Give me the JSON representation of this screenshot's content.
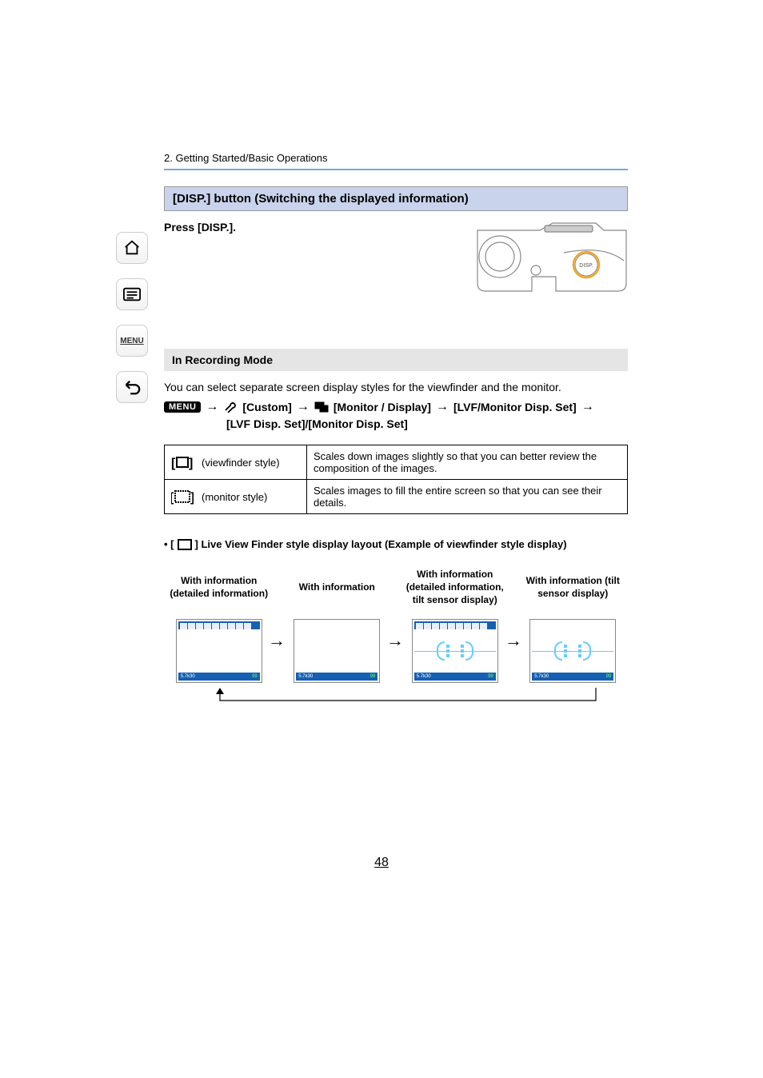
{
  "breadcrumb": "2. Getting Started/Basic Operations",
  "section_title": "[DISP.] button (Switching the displayed information)",
  "press_text": "Press [DISP.].",
  "disp_button_label": "DISP.",
  "subsection_title": "In Recording Mode",
  "intro_text": "You can select separate screen display styles for the viewfinder and the monitor.",
  "menu_path": {
    "menu_chip": "MENU",
    "arrow": "→",
    "custom": "[Custom]",
    "monitor_display": "[Monitor / Display]",
    "lvf_monitor": "[LVF/Monitor Disp. Set]",
    "line2": "[LVF Disp. Set]/[Monitor Disp. Set]"
  },
  "styles_table": {
    "row1": {
      "label": "(viewfinder style)",
      "desc": "Scales down images slightly so that you can better review the composition of the images."
    },
    "row2": {
      "label": "(monitor style)",
      "desc": "Scales images to fill the entire screen so that you can see their details."
    }
  },
  "bullet_prefix": "• [",
  "bullet_text": "] Live View Finder style display layout (Example of viewfinder style display)",
  "modes": {
    "col1": "With information (detailed information)",
    "col2": "With information",
    "col3": "With information (detailed information, tilt sensor display)",
    "col4": "With information (tilt sensor display)"
  },
  "thumb_bottom": {
    "left_a": "",
    "left_b": "5.7k30",
    "right_a": "",
    "right_b": "99"
  },
  "sidebar": {
    "home": "home-icon",
    "toc": "toc-icon",
    "menu": "MENU",
    "back": "back-icon"
  },
  "page_number": "48"
}
